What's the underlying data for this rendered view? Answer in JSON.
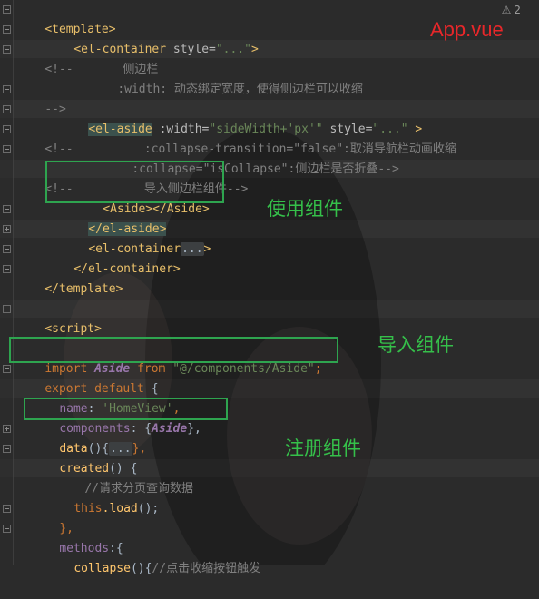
{
  "editor": {
    "warning_icon": "warning-triangle-icon",
    "warning_count": "2"
  },
  "annotations": {
    "filename": "App.vue",
    "use_component": "使用组件",
    "import_component": "导入组件",
    "register_component": "注册组件",
    "box_color": "#2ea44f",
    "label_color": "#35c04a",
    "title_color": "#e8272a"
  },
  "code": {
    "l1": "<template>",
    "l2_tag": "<el-container",
    "l2_attr": " style=",
    "l2_str": "\"...\"",
    "l2_end": ">",
    "l3_cmt": "<!--",
    "l3_text": "       侧边栏",
    "l4_text": ":width: 动态绑定宽度，使得侧边栏可以收缩",
    "l5_cmt": "-->",
    "l6_tag": "<el-aside",
    "l6_attr1": " :width=",
    "l6_str1": "\"sideWidth+'px'\"",
    "l6_attr2": " style=",
    "l6_str2": "\"...\"",
    "l6_end": " >",
    "l7_cmt": "<!--",
    "l7_text": "          :collapse-transition=\"false\":取消导航栏动画收缩",
    "l8_text": ":collapse=\"isCollapse\":侧边栏是否折叠-->",
    "l9_cmt": "<!--",
    "l9_text": "          导入侧边栏组件-->",
    "l10_open": "<Aside>",
    "l10_close": "</Aside>",
    "l11": "</el-aside>",
    "l12_tag": "<el-container",
    "l12_fold": "...",
    "l12_end": ">",
    "l13": "</el-container>",
    "l14": "</template>",
    "l16": "<script>",
    "l18_kw1": "import",
    "l18_id": "Aside",
    "l18_kw2": "from",
    "l18_str": "\"@/components/Aside\"",
    "l18_end": ";",
    "l19_kw": "export default",
    "l19_end": " {",
    "l20_prop": "name",
    "l20_colon": ": ",
    "l20_str": "'HomeView'",
    "l20_end": ",",
    "l21_prop": "components",
    "l21_mid": ": {",
    "l21_id": "Aside",
    "l21_end": "},",
    "l22_fn": "data",
    "l22_mid": "(){",
    "l22_fold": "...",
    "l22_end": "},",
    "l23_fn": "created",
    "l23_end": "() {",
    "l24_cmt": "//请求分页查询数据",
    "l25_kw": "this",
    "l25_fn": ".load",
    "l25_end": "();",
    "l26": "},",
    "l27_prop": "methods",
    "l27_end": ":{",
    "l28_fn": "collapse",
    "l28_mid": "(){",
    "l28_cmt": "//点击收缩按钮触发"
  }
}
